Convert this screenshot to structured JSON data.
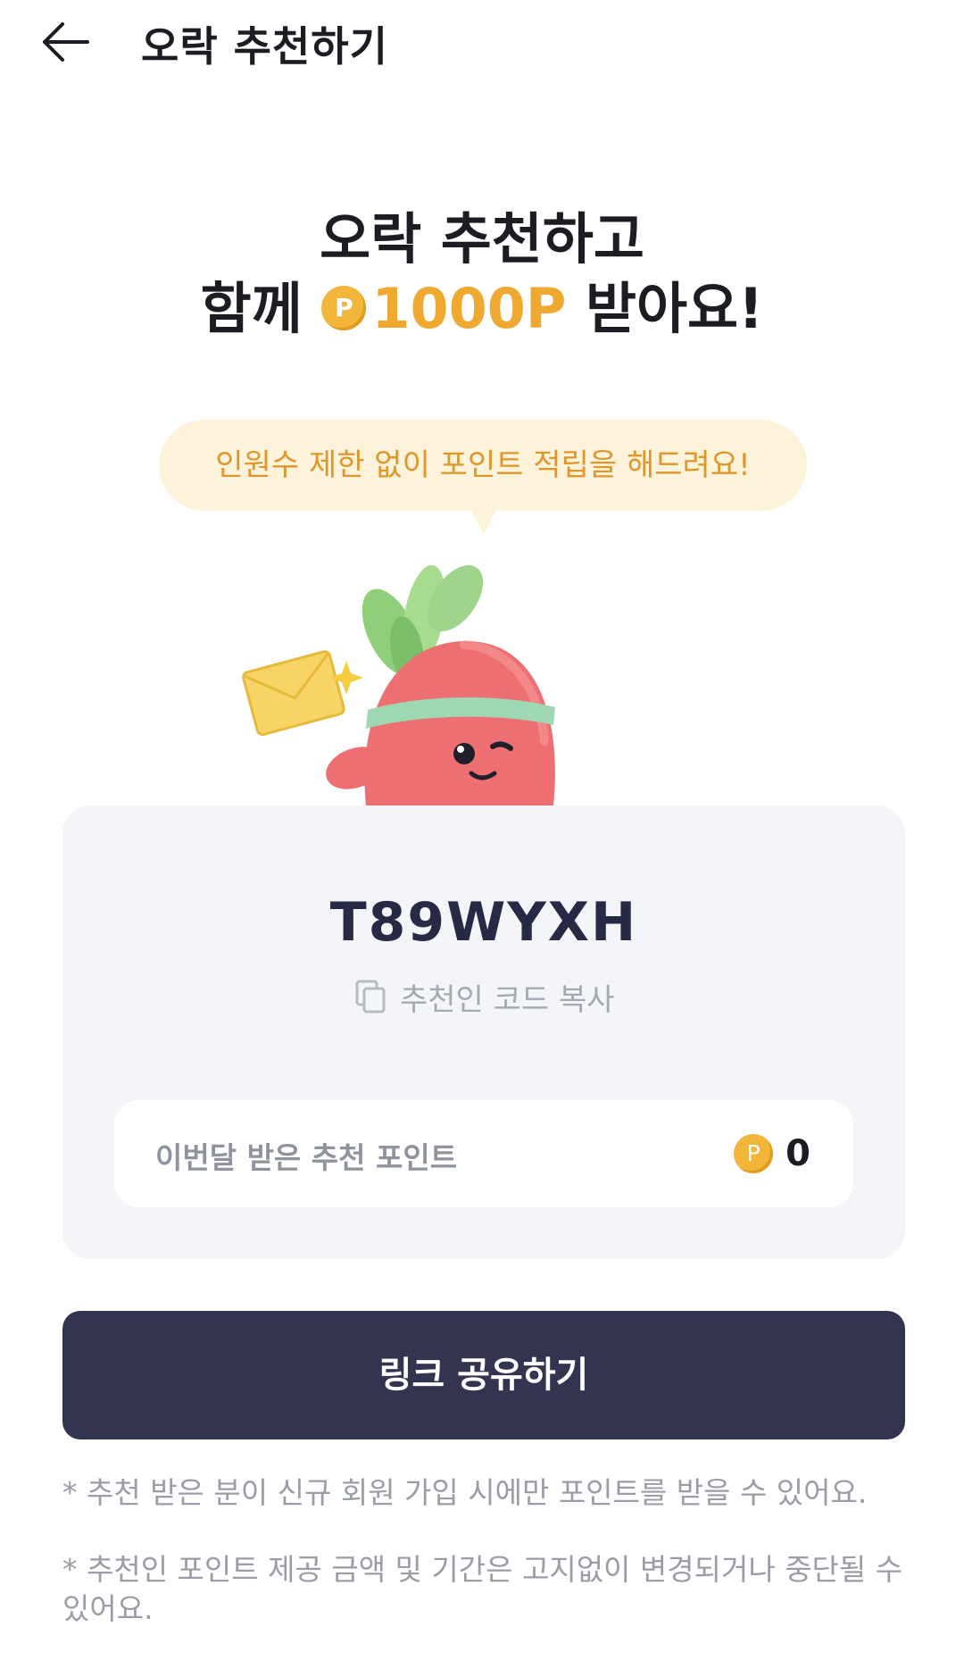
{
  "header": {
    "title": "오락 추천하기",
    "back_icon": "arrow-left-icon"
  },
  "headline": {
    "line1": "오락 추천하고",
    "line2_prefix": "함께",
    "coin_letter": "P",
    "points_amount": "1000P",
    "line2_suffix": "받아요!"
  },
  "bubble": {
    "text": "인원수 제한 없이 포인트 적립을 해드려요!"
  },
  "mascot": {
    "icon": "radish-mascot-holding-envelope"
  },
  "referral": {
    "code": "T89WYXH",
    "copy_icon": "copy-icon",
    "copy_label": "추천인 코드 복사",
    "points_label": "이번달 받은 추천 포인트",
    "coin_letter": "P",
    "points_value": "0"
  },
  "share_button": {
    "label": "링크 공유하기"
  },
  "notes": [
    "* 추천 받은 분이 신규 회원 가입 시에만 포인트를 받을 수 있어요.",
    "* 추천인 포인트 제공 금액 및 기간은 고지없이 변경되거나 중단될 수 있어요."
  ],
  "colors": {
    "accent_yellow": "#f0a930",
    "button_dark": "#33344f",
    "bubble_bg": "#fdf3db",
    "card_bg": "#f4f5f8"
  }
}
